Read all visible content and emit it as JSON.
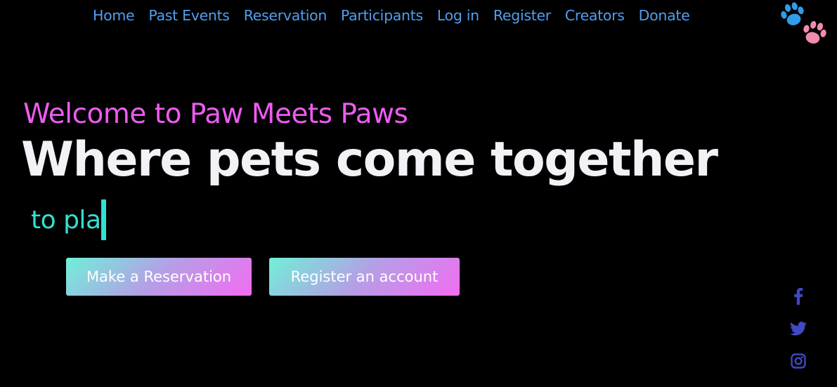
{
  "nav": {
    "items": [
      {
        "label": "Home"
      },
      {
        "label": "Past Events"
      },
      {
        "label": "Reservation"
      },
      {
        "label": "Participants"
      },
      {
        "label": "Log in"
      },
      {
        "label": "Register"
      },
      {
        "label": "Creators"
      },
      {
        "label": "Donate"
      }
    ],
    "link_color": "#4f9ff0"
  },
  "logo": {
    "icon": "paw-prints-icon"
  },
  "hero": {
    "welcome": "Welcome to Paw Meets Paws",
    "headline": "Where pets come together",
    "typed_text": "to pla",
    "colors": {
      "welcome": "#ec5cf0",
      "headline": "#f2f2f6",
      "typed": "#34e0d0"
    }
  },
  "buttons": {
    "reserve": "Make a Reservation",
    "register": "Register an account"
  },
  "social": {
    "icons": [
      "facebook-icon",
      "twitter-icon",
      "instagram-icon"
    ],
    "color": "#4149c4"
  }
}
